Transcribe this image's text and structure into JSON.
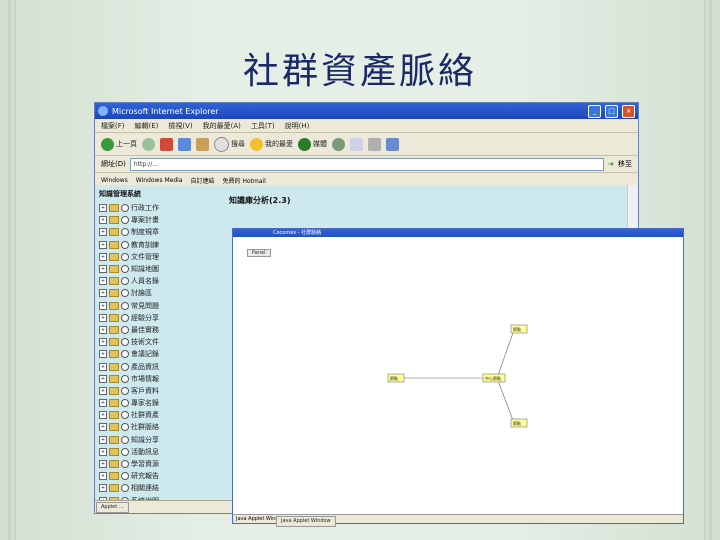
{
  "slide": {
    "title": "社群資產脈絡"
  },
  "browser": {
    "window_title": "Microsoft Internet Explorer",
    "menu": [
      "檔案(F)",
      "編輯(E)",
      "檢視(V)",
      "我的最愛(A)",
      "工具(T)",
      "說明(H)"
    ],
    "toolbar": {
      "back_label": "上一頁",
      "search_label": "搜尋",
      "favorites_label": "我的最愛",
      "media_label": "媒體"
    },
    "address_label": "網址(D)",
    "address_value": "http://...",
    "go_label": "移至",
    "links": [
      "Windows",
      "Windows Media",
      "自訂連結",
      "免費的 Hotmail"
    ],
    "status_text": "Applet ..."
  },
  "sidebar": {
    "heading": "知識管理系統",
    "items": [
      "行政工作",
      "專案計畫",
      "制度規章",
      "教育訓練",
      "文件管理",
      "知識地圖",
      "人員名錄",
      "討論區",
      "常見問題",
      "經驗分享",
      "最佳實務",
      "技術文件",
      "會議記錄",
      "產品資訊",
      "市場情報",
      "客戶資料",
      "專家名錄",
      "社群資產",
      "社群脈絡",
      "知識分享",
      "活動訊息",
      "學習資源",
      "研究報告",
      "相關連結",
      "系統說明",
      "使用者設定"
    ]
  },
  "main": {
    "header": "知識庫分析(2.3)"
  },
  "applet": {
    "title": "Cocomex - 社群脈絡",
    "tab_label": "Panel",
    "status_text": "Java Applet Window",
    "nodes": [
      {
        "id": "n-top",
        "label": "節點"
      },
      {
        "id": "n-center",
        "label": "中心節點"
      },
      {
        "id": "n-left",
        "label": "節點"
      },
      {
        "id": "n-bottom",
        "label": "節點"
      }
    ]
  },
  "taskbar": {
    "left_task": "Applet ...",
    "right_task": "Java Applet Window"
  },
  "colors": {
    "title_color": "#1a2a66",
    "content_bg": "#cde9ee",
    "node_fill": "#ffff99"
  }
}
